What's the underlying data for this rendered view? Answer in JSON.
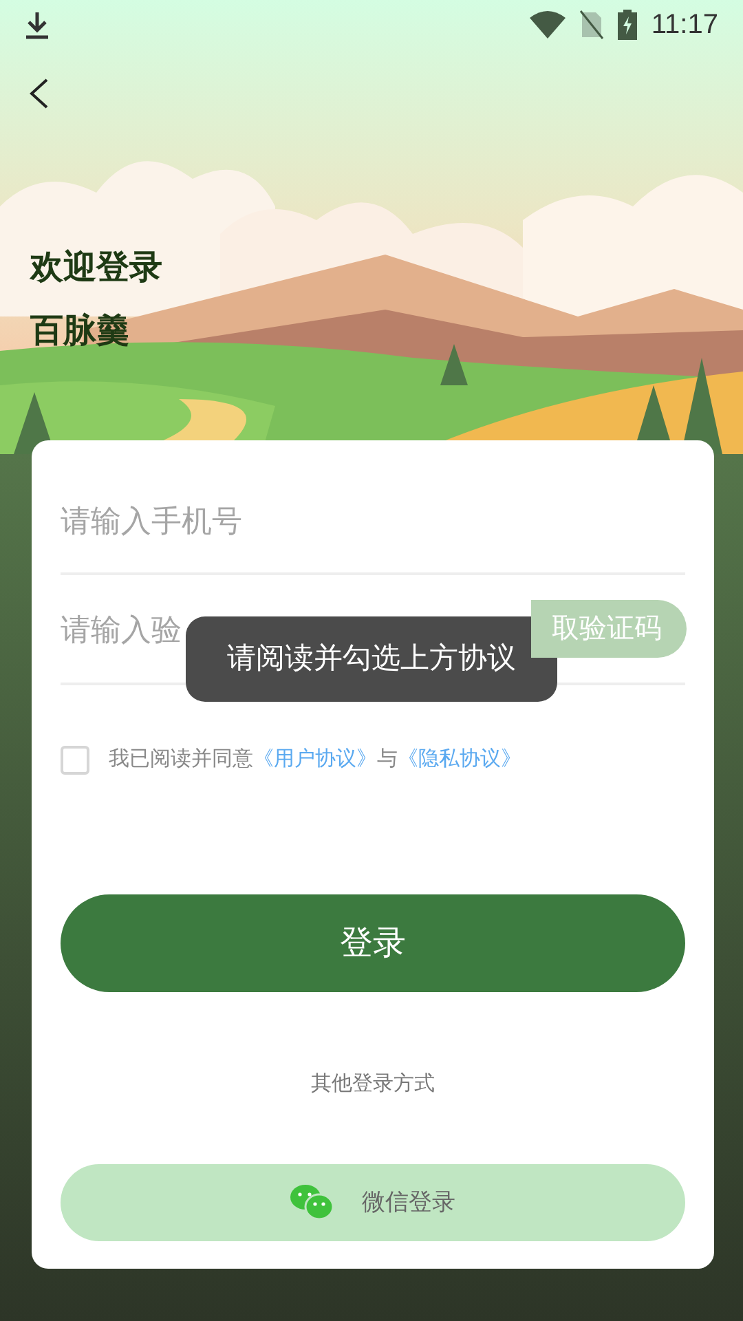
{
  "status_bar": {
    "time": "11:17"
  },
  "header": {
    "title": "欢迎登录",
    "subtitle": "百脉羹"
  },
  "form": {
    "phone": {
      "placeholder": "请输入手机号"
    },
    "code": {
      "placeholder": "请输入验"
    },
    "get_code_button": "取验证码"
  },
  "agreement": {
    "checked": false,
    "prefix": "我已阅读并同意",
    "link_1": "《用户协议》",
    "joiner": "与",
    "link_2": "《隐私协议》"
  },
  "login_button": "登录",
  "other_login_label": "其他登录方式",
  "wechat_button": "微信登录",
  "toast": "请阅读并勾选上方协议"
}
